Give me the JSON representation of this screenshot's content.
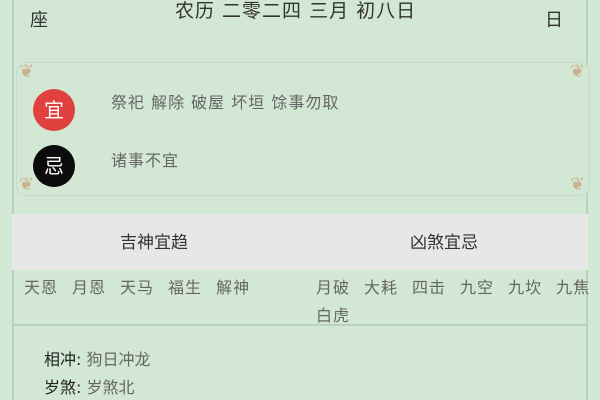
{
  "header": {
    "left_text": "座",
    "lunar_date": "农历 二零二四 三月 初八日",
    "right_text": "日"
  },
  "yi": {
    "badge": "宜",
    "items": "祭祀 解除 破屋 坏垣 馀事勿取",
    "color": "#e0413f"
  },
  "ji": {
    "badge": "忌",
    "items": "诸事不宜",
    "color": "#0b0b0b"
  },
  "gods_header": {
    "left": "吉神宜趋",
    "right": "凶煞宜忌"
  },
  "auspicious_gods": [
    "天恩",
    "月恩",
    "天马",
    "福生",
    "解神"
  ],
  "inauspicious_gods": [
    "月破",
    "大耗",
    "四击",
    "九空",
    "九坎",
    "九焦",
    "白虎"
  ],
  "details": {
    "chong_label": "相冲:",
    "chong_value": "狗日冲龙",
    "sha_label": "岁煞:",
    "sha_value": "岁煞北"
  },
  "colors": {
    "background": "#d2e8d4",
    "band": "#e7e7e7",
    "corner_ornament": "#c9b28e"
  }
}
